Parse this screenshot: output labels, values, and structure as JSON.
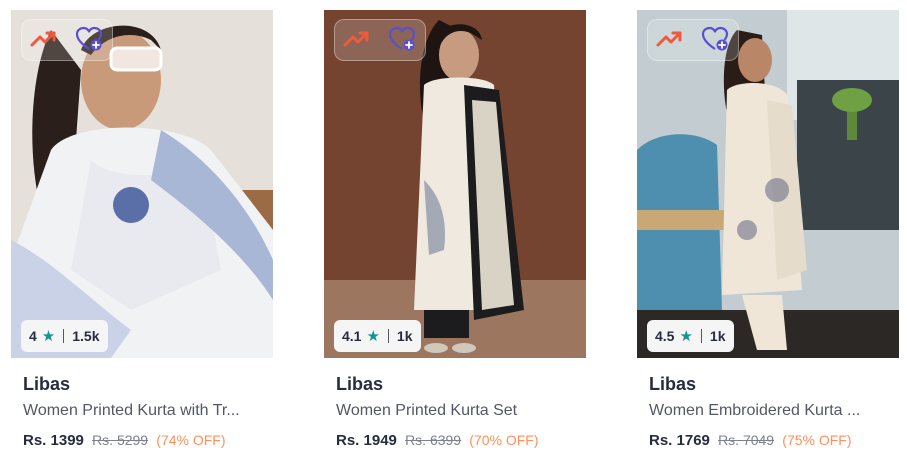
{
  "products": [
    {
      "brand": "Libas",
      "title": "Women Printed Kurta with Tr...",
      "price": "Rs. 1399",
      "mrp": "Rs. 5299",
      "discount": "(74% OFF)",
      "rating": "4",
      "rating_count": "1.5k"
    },
    {
      "brand": "Libas",
      "title": "Women Printed Kurta Set",
      "price": "Rs. 1949",
      "mrp": "Rs. 6399",
      "discount": "(70% OFF)",
      "rating": "4.1",
      "rating_count": "1k"
    },
    {
      "brand": "Libas",
      "title": "Women Embroidered Kurta ...",
      "price": "Rs. 1769",
      "mrp": "Rs. 7049",
      "discount": "(75% OFF)",
      "rating": "4.5",
      "rating_count": "1k"
    }
  ],
  "icons": {
    "trending": "trending-up-icon",
    "wishlist": "heart-plus-icon",
    "rating": "star-icon"
  },
  "colors": {
    "trending": "#ef5a3c",
    "wishlist": "#5a4fcf",
    "rating_star": "#14958f",
    "discount": "#ff905a"
  }
}
